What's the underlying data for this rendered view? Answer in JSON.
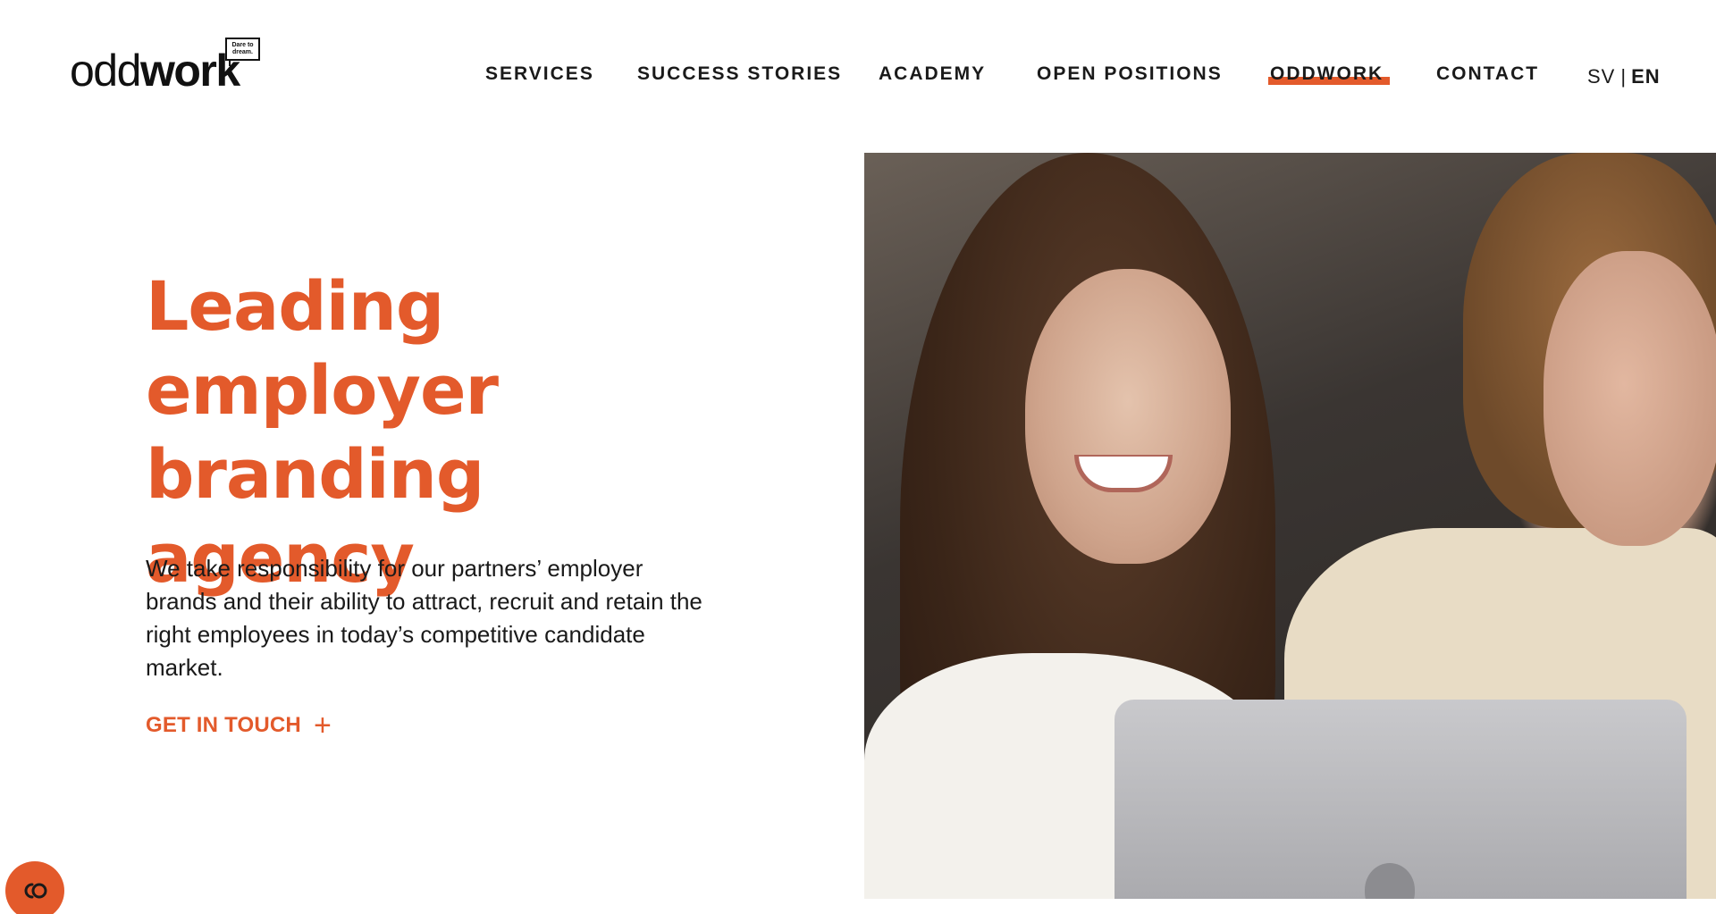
{
  "logo": {
    "word_light": "odd",
    "word_bold": "work",
    "tagline_line1": "Dare to",
    "tagline_line2": "dream."
  },
  "nav": {
    "items": [
      {
        "label": "SERVICES"
      },
      {
        "label": "SUCCESS STORIES"
      },
      {
        "label": "ACADEMY"
      },
      {
        "label": "OPEN POSITIONS"
      },
      {
        "label": "ODDWORK",
        "active": true
      },
      {
        "label": "CONTACT"
      }
    ],
    "lang": {
      "sv": "SV",
      "separator": "|",
      "en": "EN",
      "current": "EN"
    }
  },
  "hero": {
    "title_lines": [
      "Leading",
      "employer",
      "branding agency"
    ],
    "text": "We take responsibility for our partners’ employer brands and their ability to attract, recruit and retain the right employees in today’s competitive candidate market.",
    "cta_label": "GET IN TOUCH",
    "cta_icon": "plus-icon",
    "image_desc_icon": "hero-photo"
  },
  "chat": {
    "icon": "chat-icon"
  },
  "colors": {
    "accent": "#e35a2b",
    "text": "#1a1a1a",
    "background": "#ffffff"
  }
}
